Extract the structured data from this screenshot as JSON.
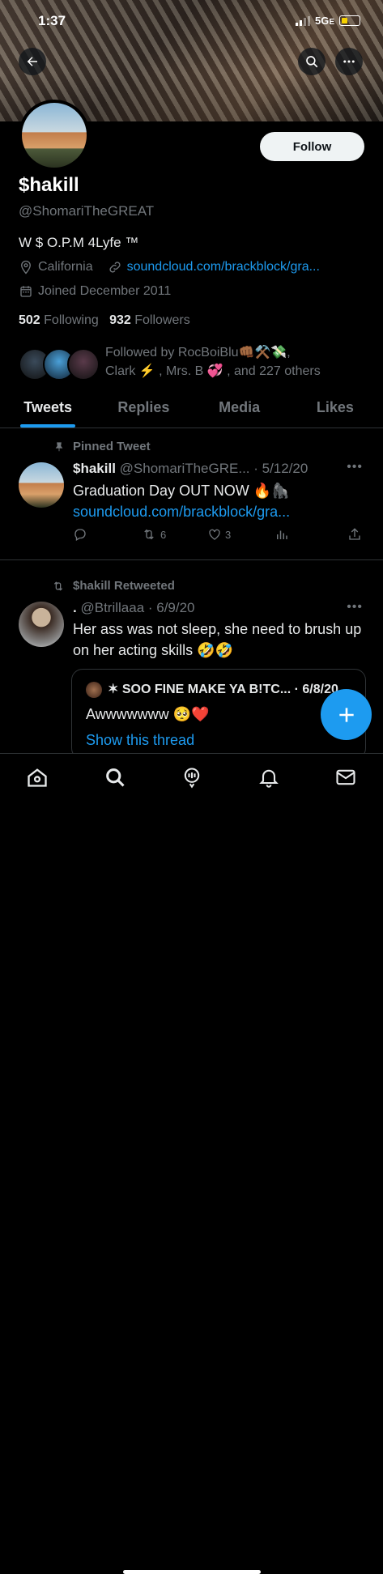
{
  "status_bar": {
    "time": "1:37",
    "network": "5G",
    "network_suffix": "E"
  },
  "profile": {
    "name": "$hakill",
    "handle": "@ShomariTheGREAT",
    "bio": "W $ O.P.M 4Lyfe ™",
    "location": "California",
    "website": "soundcloud.com/brackblock/gra...",
    "joined": "Joined December 2011",
    "following_count": "502",
    "following_label": "Following",
    "followers_count": "932",
    "followers_label": "Followers",
    "followed_by_line1": "Followed by RocBoiBlu👊🏾⚒️💸,",
    "followed_by_line2": "Clark ⚡ , Mrs. B 💞 , and 227 others",
    "follow_button": "Follow"
  },
  "tabs": [
    {
      "label": "Tweets",
      "active": true
    },
    {
      "label": "Replies",
      "active": false
    },
    {
      "label": "Media",
      "active": false
    },
    {
      "label": "Likes",
      "active": false
    }
  ],
  "tweets": [
    {
      "context": "Pinned Tweet",
      "name": "$hakill",
      "handle_date": "@ShomariTheGRE... · 5/12/20",
      "text": "Graduation Day OUT NOW 🔥🦍",
      "link": "soundcloud.com/brackblock/gra...",
      "retweets": "6",
      "likes": "3"
    },
    {
      "context": "$hakill Retweeted",
      "name": ".",
      "handle_date": "@Btrillaaa · 6/9/20",
      "text": "Her ass was not sleep, she need to brush up on her acting skills 🤣🤣",
      "quote": {
        "author": "✶ SOO FINE MAKE YA B!TC... · 6/8/20",
        "text": "Awwwwwww 🥺❤️",
        "show_thread": "Show this thread"
      }
    }
  ],
  "colors": {
    "accent": "#1d9bf0",
    "background": "#000000",
    "muted": "#71767b",
    "text": "#e7e9ea"
  },
  "icons": [
    "back-arrow-icon",
    "search-icon",
    "more-icon",
    "location-pin-icon",
    "link-icon",
    "calendar-icon",
    "pin-icon",
    "retweet-icon",
    "reply-icon",
    "like-icon",
    "analytics-icon",
    "share-icon",
    "compose-plus-icon",
    "home-icon",
    "spaces-icon",
    "notifications-icon",
    "messages-icon"
  ]
}
